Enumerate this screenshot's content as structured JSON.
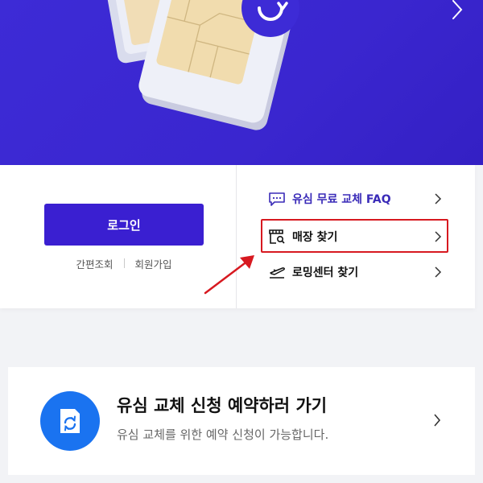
{
  "banner": {
    "next_icon": "chevron-right-icon",
    "image": "sim-card-illustration",
    "refresh_badge_icon": "refresh-icon"
  },
  "login": {
    "button_label": "로그인",
    "quick_lookup": "간편조회",
    "sign_up": "회원가입"
  },
  "menu": {
    "items": [
      {
        "label": "유심 무료 교체 FAQ",
        "icon": "chat-dots-icon",
        "color": "#3a2bb8"
      },
      {
        "label": "매장 찾기",
        "icon": "store-search-icon",
        "highlighted": true
      },
      {
        "label": "로밍센터 찾기",
        "icon": "airplane-icon"
      }
    ]
  },
  "reservation": {
    "title": "유심 교체 신청 예약하러 가기",
    "description": "유심 교체를 위한 예약 신청이 가능합니다.",
    "icon": "sim-refresh-icon",
    "icon_bg": "#1a73f0"
  },
  "colors": {
    "brand": "#3a1fd1",
    "banner_bg": "#3d2bd6",
    "highlight": "#d71920"
  }
}
